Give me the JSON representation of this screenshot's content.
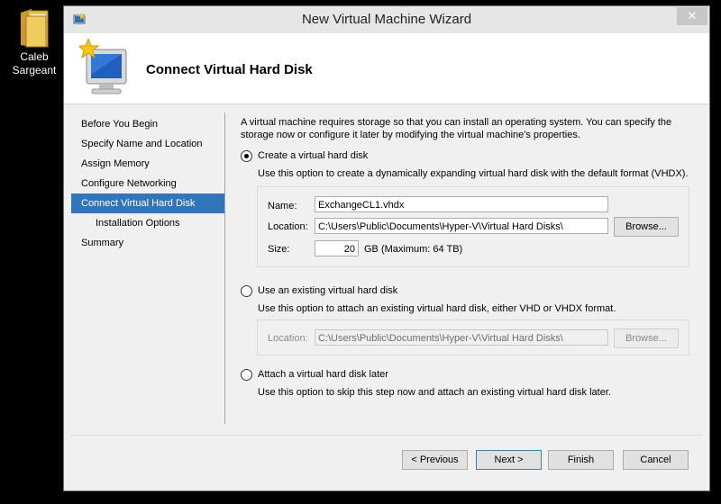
{
  "desktop": {
    "icon_label": "Caleb Sargeant"
  },
  "window": {
    "title": "New Virtual Machine Wizard",
    "close_glyph": "✕",
    "page_title": "Connect Virtual Hard Disk"
  },
  "nav": {
    "items": [
      {
        "label": "Before You Begin"
      },
      {
        "label": "Specify Name and Location"
      },
      {
        "label": "Assign Memory"
      },
      {
        "label": "Configure Networking"
      },
      {
        "label": "Connect Virtual Hard Disk"
      },
      {
        "label": "Installation Options"
      },
      {
        "label": "Summary"
      }
    ]
  },
  "content": {
    "intro": "A virtual machine requires storage so that you can install an operating system. You can specify the storage now or configure it later by modifying the virtual machine's properties.",
    "create": {
      "label": "Create a virtual hard disk",
      "desc": "Use this option to create a dynamically expanding virtual hard disk with the default format (VHDX).",
      "name_label": "Name:",
      "name_value": "ExchangeCL1.vhdx",
      "location_label": "Location:",
      "location_value": "C:\\Users\\Public\\Documents\\Hyper-V\\Virtual Hard Disks\\",
      "browse_label": "Browse...",
      "size_label": "Size:",
      "size_value": "20",
      "size_unit": "GB (Maximum: 64 TB)"
    },
    "existing": {
      "label": "Use an existing virtual hard disk",
      "desc": "Use this option to attach an existing virtual hard disk, either VHD or VHDX format.",
      "location_label": "Location:",
      "location_value": "C:\\Users\\Public\\Documents\\Hyper-V\\Virtual Hard Disks\\",
      "browse_label": "Browse..."
    },
    "later": {
      "label": "Attach a virtual hard disk later",
      "desc": "Use this option to skip this step now and attach an existing virtual hard disk later."
    }
  },
  "footer": {
    "previous_label": "< Previous",
    "next_label": "Next >",
    "finish_label": "Finish",
    "cancel_label": "Cancel"
  },
  "colors": {
    "accent": "#3176b9",
    "titlebar": "#e6e6e6",
    "close": "#c7c7c7"
  }
}
